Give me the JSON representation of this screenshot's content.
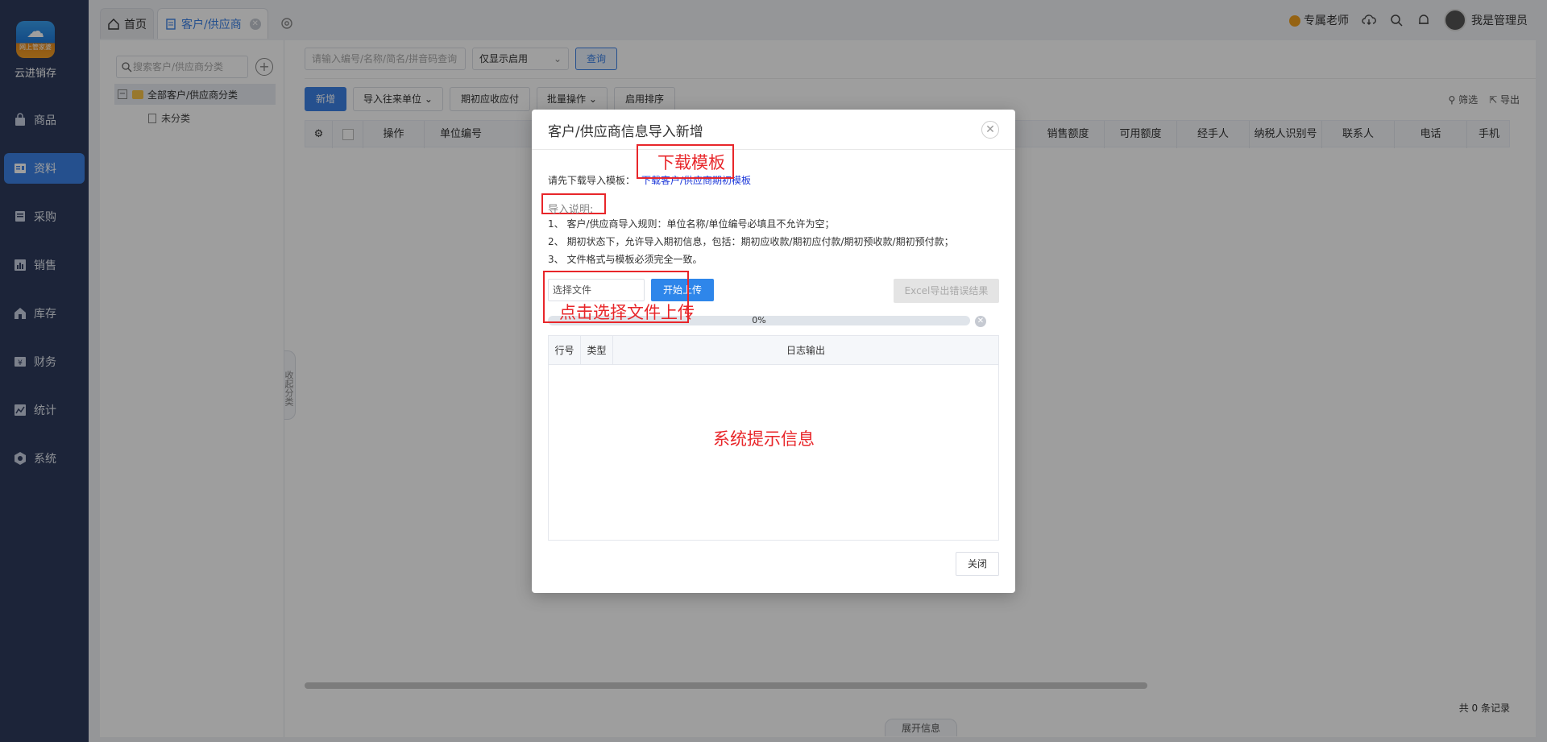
{
  "app": {
    "logo_tag": "网上管家婆",
    "name": "云进销存"
  },
  "sidebar": {
    "items": [
      {
        "label": "商品",
        "icon": "bag-icon"
      },
      {
        "label": "资料",
        "icon": "document-icon",
        "active": true
      },
      {
        "label": "采购",
        "icon": "purchase-icon"
      },
      {
        "label": "销售",
        "icon": "chart-icon"
      },
      {
        "label": "库存",
        "icon": "warehouse-icon"
      },
      {
        "label": "财务",
        "icon": "finance-icon"
      },
      {
        "label": "统计",
        "icon": "stats-icon"
      },
      {
        "label": "系统",
        "icon": "system-icon"
      }
    ]
  },
  "tabs": {
    "home": "首页",
    "current": "客户/供应商"
  },
  "topbar": {
    "teacher": "专属老师",
    "user": "我是管理员"
  },
  "tree": {
    "search_placeholder": "搜索客户/供应商分类",
    "root": "全部客户/供应商分类",
    "child": "未分类",
    "collapse_label": "收起分类"
  },
  "filters": {
    "search_placeholder": "请输入编号/名称/简名/拼音码查询",
    "status_select": "仅显示启用",
    "query_button": "查询"
  },
  "toolbar": {
    "add": "新增",
    "import": "导入往来单位",
    "opening": "期初应收应付",
    "batch": "批量操作",
    "sort": "启用排序",
    "filter": "筛选",
    "export": "导出"
  },
  "table": {
    "columns_left": [
      "操作",
      "单位编号"
    ],
    "columns_right": [
      "销售额度",
      "可用额度",
      "经手人",
      "纳税人识别号",
      "联系人",
      "电话",
      "手机"
    ],
    "total": "共 0 条记录",
    "expand_info": "展开信息"
  },
  "modal": {
    "title": "客户/供应商信息导入新增",
    "download_label": "请先下载导入模板：",
    "download_link": "下载客户/供应商期初模板",
    "note_title": "导入说明:",
    "notes": [
      "1、 客户/供应商导入规则：单位名称/单位编号必填且不允许为空；",
      "2、 期初状态下，允许导入期初信息，包括：期初应收款/期初应付款/期初预收款/期初预付款；",
      "3、 文件格式与模板必须完全一致。"
    ],
    "file_input": "选择文件",
    "upload_button": "开始上传",
    "export_errors_button": "Excel导出错误结果",
    "progress_text": "0%",
    "progress_value": 0,
    "log_columns": [
      "行号",
      "类型",
      "日志输出"
    ],
    "close_button": "关闭"
  },
  "annotations": {
    "download_template": "下载模板",
    "choose_file": "点击选择文件上传",
    "system_info": "系统提示信息",
    "color": "#e8262a"
  }
}
